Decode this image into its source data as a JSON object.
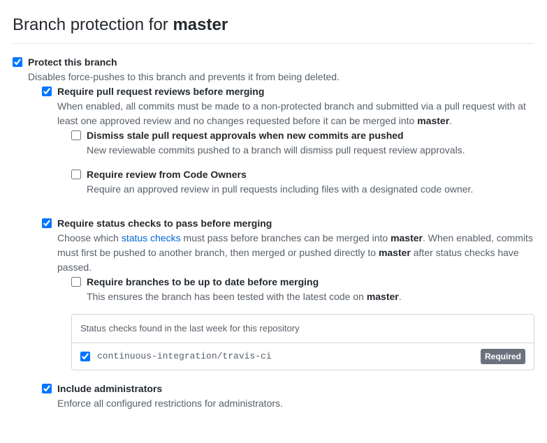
{
  "header": {
    "prefix": "Branch protection for ",
    "branch": "master"
  },
  "protect": {
    "label": "Protect this branch",
    "desc": "Disables force-pushes to this branch and prevents it from being deleted.",
    "checked": true
  },
  "requireReviews": {
    "label": "Require pull request reviews before merging",
    "desc_pre": "When enabled, all commits must be made to a non-protected branch and submitted via a pull request with at least one approved review and no changes requested before it can be merged into ",
    "branch": "master",
    "desc_post": ".",
    "checked": true
  },
  "dismissStale": {
    "label": "Dismiss stale pull request approvals when new commits are pushed",
    "desc": "New reviewable commits pushed to a branch will dismiss pull request review approvals.",
    "checked": false
  },
  "codeOwners": {
    "label": "Require review from Code Owners",
    "desc": "Require an approved review in pull requests including files with a designated code owner.",
    "checked": false
  },
  "requireStatus": {
    "label": "Require status checks to pass before merging",
    "desc_1": "Choose which ",
    "link": "status checks",
    "desc_2": " must pass before branches can be merged into ",
    "branch1": "master",
    "desc_3": ". When enabled, commits must first be pushed to another branch, then merged or pushed directly to ",
    "branch2": "master",
    "desc_4": " after status checks have passed.",
    "checked": true
  },
  "upToDate": {
    "label": "Require branches to be up to date before merging",
    "desc_pre": "This ensures the branch has been tested with the latest code on ",
    "branch": "master",
    "desc_post": ".",
    "checked": false
  },
  "statusBox": {
    "heading": "Status checks found in the last week for this repository",
    "check_name": "continuous-integration/travis-ci",
    "check_checked": true,
    "badge": "Required"
  },
  "includeAdmins": {
    "label": "Include administrators",
    "desc": "Enforce all configured restrictions for administrators.",
    "checked": true
  }
}
